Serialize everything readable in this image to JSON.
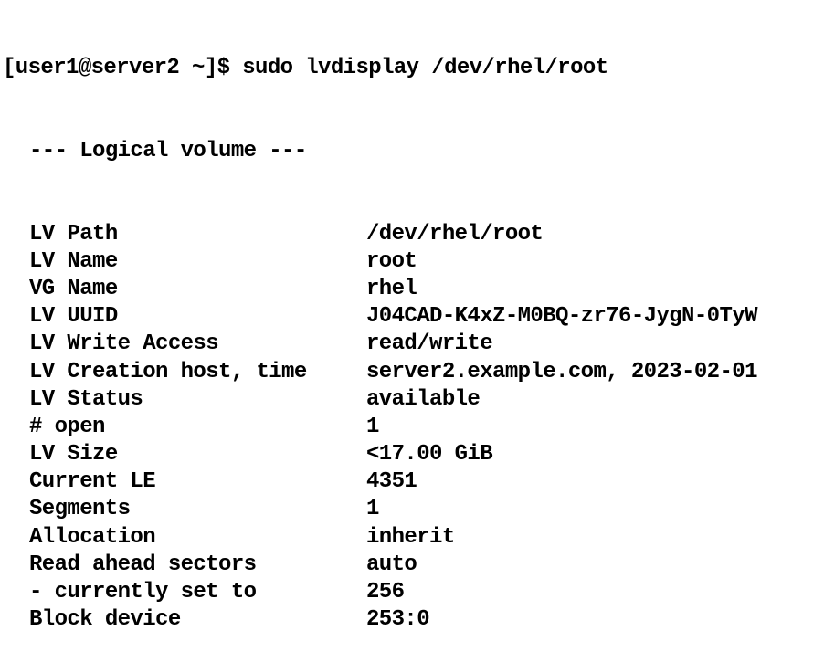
{
  "terminal": {
    "prompt": "[user1@server2 ~]$ sudo lvdisplay /dev/rhel/root",
    "section_header": "--- Logical volume ---",
    "rows": [
      {
        "label": "LV Path",
        "value": "/dev/rhel/root"
      },
      {
        "label": "LV Name",
        "value": "root"
      },
      {
        "label": "VG Name",
        "value": "rhel"
      },
      {
        "label": "LV UUID",
        "value": "J04CAD-K4xZ-M0BQ-zr76-JygN-0TyW"
      },
      {
        "label": "LV Write Access",
        "value": "read/write"
      },
      {
        "label": "LV Creation host, time",
        "value": "server2.example.com, 2023-02-01"
      },
      {
        "label": "LV Status",
        "value": "available"
      },
      {
        "label": "# open",
        "value": "1"
      },
      {
        "label": "LV Size",
        "value": "<17.00 GiB"
      },
      {
        "label": "Current LE",
        "value": "4351"
      },
      {
        "label": "Segments",
        "value": "1"
      },
      {
        "label": "Allocation",
        "value": "inherit"
      },
      {
        "label": "Read ahead sectors",
        "value": "auto"
      },
      {
        "label": "- currently set to",
        "value": "256"
      },
      {
        "label": "Block device",
        "value": "253:0"
      }
    ]
  }
}
